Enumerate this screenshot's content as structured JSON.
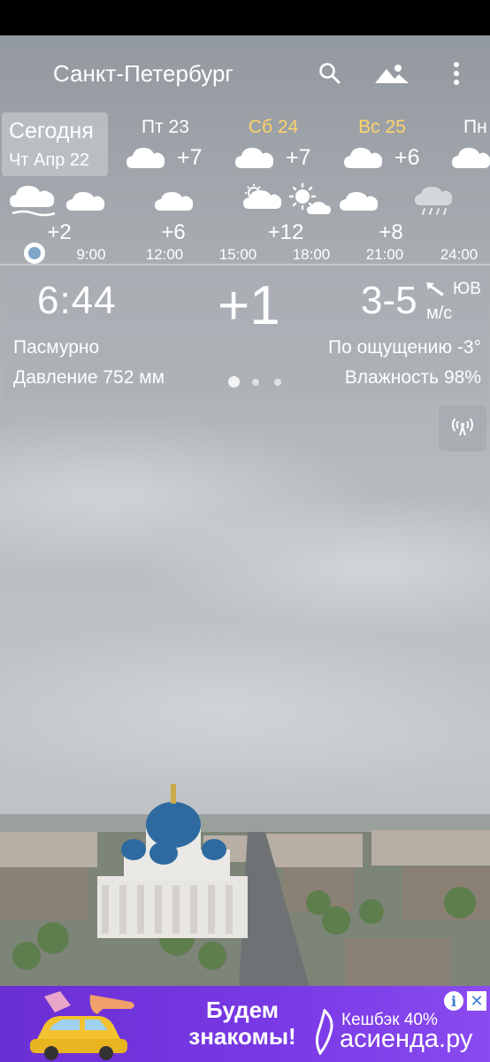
{
  "header": {
    "city": "Санкт-Петербург",
    "icons": [
      "search-icon",
      "mountain-icon",
      "more-vert-icon"
    ]
  },
  "daily": {
    "today_title": "Сегодня",
    "today_date": "Чт Апр 22",
    "days": [
      {
        "name": "Пт 23",
        "temp": "+7",
        "icon": "cloud-icon",
        "color": "#ffffff"
      },
      {
        "name": "Сб 24",
        "temp": "+7",
        "icon": "cloud-icon",
        "color": "#ffd36b"
      },
      {
        "name": "Вс 25",
        "temp": "+6",
        "icon": "cloud-icon",
        "color": "#ffd36b"
      },
      {
        "name": "Пн",
        "temp": "",
        "icon": "cloud-icon",
        "color": "#ffffff"
      }
    ]
  },
  "hourly": {
    "temps": [
      "+2",
      "+6",
      "+12",
      "+8"
    ],
    "times": [
      "9:00",
      "12:00",
      "15:00",
      "18:00",
      "21:00",
      "24:00"
    ],
    "icons": [
      "fog-cloud-icon",
      "cloud-icon",
      "cloud-icon",
      "sun-cloud-icon",
      "sun-icon",
      "cloud-icon",
      "rain-cloud-icon"
    ]
  },
  "current": {
    "time": "6:44",
    "temp": "+1",
    "wind_speed": "3-5",
    "wind_unit": "м/с",
    "wind_dir": "ЮВ",
    "condition": "Пасмурно",
    "feels_like": "По ощущению -3°",
    "pressure": "Давление 752 мм",
    "humidity": "Влажность 98%",
    "page_count": 3,
    "active_page": 1
  },
  "radar": {
    "icon": "radar-icon"
  },
  "ad": {
    "headline": "Будем знакомы!",
    "cashback": "Кешбэк 40%",
    "brand": "асиенда.ру",
    "info": "i",
    "close": "✕"
  },
  "colors": {
    "accent_yellow": "#ffd36b",
    "ad_purple": "#7a3ae6",
    "now_dot": "#7fa6c8"
  }
}
